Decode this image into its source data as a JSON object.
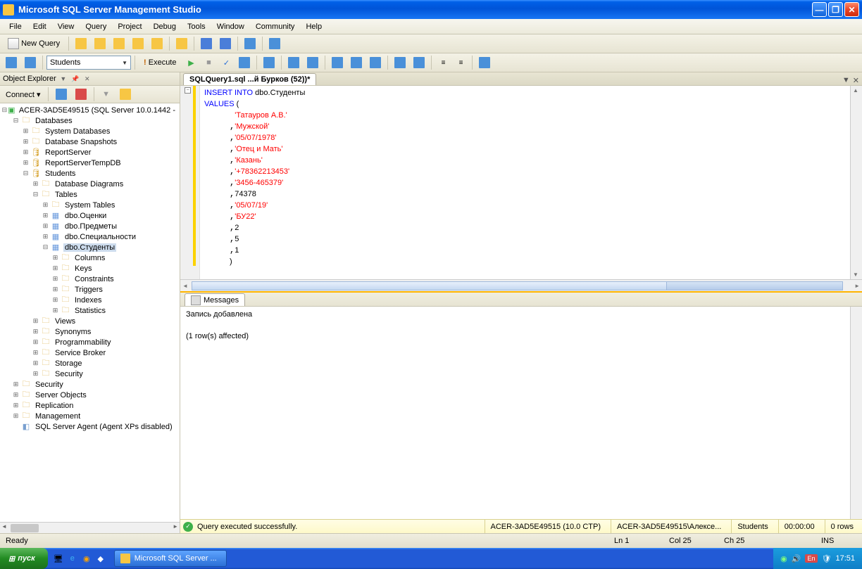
{
  "window": {
    "title": "Microsoft SQL Server Management Studio"
  },
  "menu": [
    "File",
    "Edit",
    "View",
    "Query",
    "Project",
    "Debug",
    "Tools",
    "Window",
    "Community",
    "Help"
  ],
  "toolbar1": {
    "newQuery": "New Query"
  },
  "toolbar2": {
    "dbCombo": "Students",
    "execute": "Execute"
  },
  "objectExplorer": {
    "title": "Object Explorer",
    "connect": "Connect",
    "root": "ACER-3AD5E49515 (SQL Server 10.0.1442 -",
    "databases": "Databases",
    "sysDb": "System Databases",
    "dbSnap": "Database Snapshots",
    "reportServer": "ReportServer",
    "reportServerTemp": "ReportServerTempDB",
    "students": "Students",
    "dbDiagrams": "Database Diagrams",
    "tables": "Tables",
    "sysTables": "System Tables",
    "t1": "dbo.Оценки",
    "t2": "dbo.Предметы",
    "t3": "dbo.Специальности",
    "t4": "dbo.Студенты",
    "columns": "Columns",
    "keys": "Keys",
    "constraints": "Constraints",
    "triggers": "Triggers",
    "indexes": "Indexes",
    "statistics": "Statistics",
    "views": "Views",
    "synonyms": "Synonyms",
    "programmability": "Programmability",
    "serviceBroker": "Service Broker",
    "storage": "Storage",
    "securityInner": "Security",
    "security": "Security",
    "serverObjects": "Server Objects",
    "replication": "Replication",
    "management": "Management",
    "agent": "SQL Server Agent (Agent XPs disabled)"
  },
  "docTab": "SQLQuery1.sql ...й Бурков (52))*",
  "sql": {
    "l1a": "INSERT INTO ",
    "l1b": "dbo",
    "l1c": ".",
    "l1d": "Студенты",
    "l2": "VALUES ",
    "l2p": "(",
    "v1": "'Татауров А.В.'",
    "v2": "'Мужской'",
    "v3": "'05/07/1978'",
    "v4": "'Отец и Мать'",
    "v5": "'Казань'",
    "v6": "'+78362213453'",
    "v7": "'3456-465379'",
    "v8": "74378",
    "v9": "'05/07/19'",
    "v10": "'БУ22'",
    "v11": "2",
    "v12": "5",
    "v13": "1",
    "close": ")"
  },
  "messages": {
    "tab": "Messages",
    "line1": "Запись добавлена",
    "line2": "(1 row(s) affected)"
  },
  "queryStatus": {
    "msg": "Query executed successfully.",
    "server": "ACER-3AD5E49515 (10.0 CTP)",
    "user": "ACER-3AD5E49515\\Алексе...",
    "db": "Students",
    "time": "00:00:00",
    "rows": "0 rows"
  },
  "appStatus": {
    "ready": "Ready",
    "ln": "Ln 1",
    "col": "Col 25",
    "ch": "Ch 25",
    "ins": "INS"
  },
  "taskbar": {
    "start": "пуск",
    "task1": "Microsoft SQL Server ...",
    "lang": "En",
    "clock": "17:51"
  }
}
